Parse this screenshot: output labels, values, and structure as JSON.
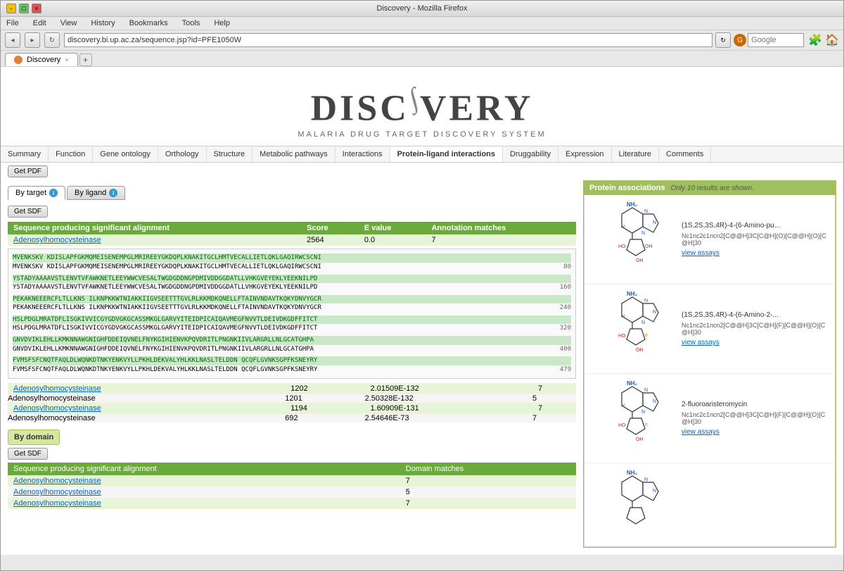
{
  "browser": {
    "title": "Discovery - Mozilla Firefox",
    "url": "discovery.bi.up.ac.za/sequence.jsp?id=PFE1050W",
    "tab_label": "Discovery"
  },
  "menu": {
    "items": [
      "File",
      "Edit",
      "View",
      "History",
      "Bookmarks",
      "Tools",
      "Help"
    ]
  },
  "header": {
    "title_part1": "DISC",
    "title_part2": "VERY",
    "subtitle": "MALARIA DRUG TARGET DISCOVERY SYSTEM"
  },
  "nav_tabs": [
    {
      "label": "Summary",
      "active": false
    },
    {
      "label": "Function",
      "active": false
    },
    {
      "label": "Gene ontology",
      "active": false
    },
    {
      "label": "Orthology",
      "active": false
    },
    {
      "label": "Structure",
      "active": false
    },
    {
      "label": "Metabolic pathways",
      "active": false
    },
    {
      "label": "Interactions",
      "active": false
    },
    {
      "label": "Protein-ligand interactions",
      "active": true
    },
    {
      "label": "Druggability",
      "active": false
    },
    {
      "label": "Expression",
      "active": false
    },
    {
      "label": "Literature",
      "active": false
    },
    {
      "label": "Comments",
      "active": false
    }
  ],
  "pdf_btn": "Get PDF",
  "sub_tabs": [
    {
      "label": "By target",
      "active": true
    },
    {
      "label": "By ligand",
      "active": false
    }
  ],
  "get_sdf": "Get SDF",
  "table": {
    "headers": [
      "Sequence producing significant alignment",
      "Score",
      "E value",
      "Annotation matches"
    ],
    "rows": [
      {
        "name": "Adenosylhomocysteinase",
        "score": "2564",
        "evalue": "0.0",
        "matches": "7"
      },
      {
        "name": "Adenosylhomocysteinase",
        "score": "1202",
        "evalue": "2.01509E-132",
        "matches": "7"
      },
      {
        "name": "Adenosylhomocysteinase",
        "score": "1201",
        "evalue": "2.50328E-132",
        "matches": "5"
      },
      {
        "name": "Adenosylhomocysteinase",
        "score": "1194",
        "evalue": "1.60909E-131",
        "matches": "7"
      },
      {
        "name": "Adenosylhomocysteinase",
        "score": "692",
        "evalue": "2.54646E-73",
        "matches": "7"
      }
    ]
  },
  "sequence": {
    "lines": [
      {
        "text1": "MVENKSKV KDISLAPFGKMQMEISENEMPGLMRIREEYGKDQPLKNAKITGCLHMTVECALLIETLQKLGAQIRWCSCNI",
        "text2": "MVENKSKV KDISLAPFGKMQMEISENEMPGLMRIREEYGKDQPLKNAKITGCLHMTVECALLIETLQKLGAQIRWCSCNI",
        "num": "80"
      },
      {
        "text1": "YSTADYAAAAVSTLENVTVFAWKNETLEEYWWCVESALTWGDGDDNGPDMIVDDGGDATLLVHKGVEYEKLYEEKNILPD",
        "text2": "YSTADYAAAAVSTLENVTVFAWKNETLEEYWWCVESALTWGDGDDNGPDMIVDDGGDATLLVHKGVEYEKLYEEKNILPD",
        "num": "160"
      },
      {
        "text1": "PEKAKNEEERCFLTLLKNS ILKNPKKWTNIAKKIIGVSEETTTGVLRLKKMDKQNELLFTAINVNDAVTKQKYDNVYGCR",
        "text2": "PEKAKNEEERCFLTLLKNS ILKNPKKWTNIAKKIIGVSEETTTGVLRLKKMDKQNELLFTAINVNDAVTKQKYDNVYGCR",
        "num": "240"
      },
      {
        "text1": "HSLPDGLMRATDFLISGKIVVICGYGDVGKGCASSMKGLGARVYITEIDPICAIQAVMEGFNVVTLDEIVDKGDFFITCT",
        "text2": "HSLPDGLMRATDFLISGKIVVICGYGDVGKGCASSMKGLGARVYITEIDPICAIQAVMEGFNVVTLDEIVDKGDFFITCT",
        "num": "320"
      },
      {
        "text1": "GNVDVIKLEHLLKMKNNAWGNIGHFDDEIQVNELFNYKGIHIENVKPQVDRITLPNGNKIIVLARGRLLNLGCATGHPA",
        "text2": "GNVDVIKLEHLLKMKNNAWGNIGHFDDEIQVNELFNYKGIHIENVKPQVDRITLPNGNKIIVLARGRLLNLGCATGHPA",
        "num": "400"
      },
      {
        "text1": "FVMSFSFCNQTFAQLDLWQNKDTNKYENKVYLLPKHLDEKVALYHLKKLNASLTELDDN QCQFLGVNKSGPFKSNEYRY",
        "text2": "FVMSFSFCNQTFAQLDLWQNKDTNKYENKVYLLPKHLDEKVALYHLKKLNASLTELDDN QCQFLGVNKSGPFKSNEYRY",
        "num": "479"
      }
    ]
  },
  "domain": {
    "header": "By domain",
    "get_sdf": "Get SDF",
    "table_headers": [
      "Sequence producing significant alignment",
      "Domain matches"
    ],
    "rows": [
      {
        "name": "Adenosylhomocysteinase",
        "matches": "7"
      },
      {
        "name": "Adenosylhomocysteinase",
        "matches": "5"
      },
      {
        "name": "Adenosylhomocysteinase",
        "matches": "7"
      }
    ]
  },
  "protein_assoc": {
    "header": "Protein associations",
    "note": "Only 10 results are shown.",
    "items": [
      {
        "name": "(1S,2S,3S,4R)-4-(6-Amino-pu...",
        "formula": "Nc1nc2c1ncn2[C@@H]3C[C@H](O)[C@@H](O)[C@H]30",
        "view_assay": "view assays"
      },
      {
        "name": "(1S,2S,3S,4R)-4-(6-Amino-2-...",
        "formula": "Nc1nc2c1ncn2[C@@H]3C[C@H](F)[C@@H](O)[C@H]30",
        "view_assay": "view assays"
      },
      {
        "name": "2-fluoroaristeromycin",
        "formula": "Nc1nc2c1ncn2[C@@H]3C[C@H](F)[C@@H](O)[C@H]30",
        "view_assay": "view assays"
      }
    ]
  }
}
